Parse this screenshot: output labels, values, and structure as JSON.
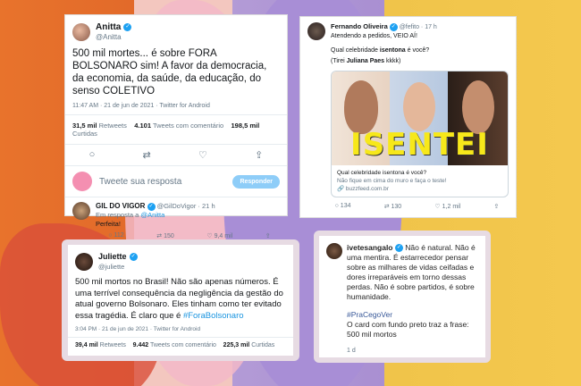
{
  "anitta": {
    "name": "Anitta",
    "handle": "@Anitta",
    "text": "500 mil mortes... é sobre FORA BOLSONARO sim! A favor da democracia, da economia, da saúde,  da educação, do senso COLETIVO",
    "meta": "11:47 AM · 21 de jun de 2021 · Twitter for Android",
    "retweets": "31,5 mil",
    "retweets_label": "Retweets",
    "comments": "4.101",
    "comments_label": "Tweets com comentário",
    "likes": "198,5 mil",
    "likes_label": "Curtidas",
    "reply_placeholder": "Tweete sua resposta",
    "reply_button": "Responder",
    "reply": {
      "name": "GIL DO VIGOR",
      "handle": "@GilDoVigor · 21 h",
      "in_reply": "Em resposta a",
      "in_reply_handle": "@Anitta",
      "text": "Perfeita!",
      "replies": "112",
      "retweets": "150",
      "likes": "9,4 mil"
    }
  },
  "fernando": {
    "name": "Fernando Oliveira",
    "handle": "@fefito · 17 h",
    "line1": "Atendendo a pedidos, VEIO AÍ!",
    "line2_pre": "Qual celebridade ",
    "line2_bold": "isentona",
    "line2_post": " é você?",
    "line3_pre": "(Tirei ",
    "line3_bold": "Juliana Paes",
    "line3_post": " kkkk)",
    "image_text": "ISENTEI",
    "link_title": "Qual celebridade isentona é você?",
    "link_desc": "Não fique em cima do muro e faça o teste!",
    "link_domain": "buzzfeed.com.br",
    "replies": "134",
    "retweets": "130",
    "likes": "1,2 mil"
  },
  "juliette": {
    "name": "Juliette",
    "handle": "@juliette",
    "text_main": "500 mil mortos no Brasil! Não são apenas números. É uma terrível consequência da negligência da gestão do atual governo Bolsonaro. Eles tinham como ter evitado essa tragédia. É claro que é ",
    "hashtag": "#ForaBolsonaro",
    "meta": "3:04 PM · 21 de jun de 2021 · Twitter for Android",
    "retweets": "39,4 mil",
    "retweets_label": "Retweets",
    "comments": "9.442",
    "comments_label": "Tweets com comentário",
    "likes": "225,3 mil",
    "likes_label": "Curtidas"
  },
  "ivete": {
    "handle": "ivetesangalo",
    "text": "Não é natural. Não é uma mentira. É estarrecedor pensar sobre as milhares de vidas ceifadas e dores irreparáveis em torno dessas perdas. Não é sobre partidos, é sobre humanidade.",
    "hashtag": "#PraCegoVer",
    "description": "O card com fundo preto traz a frase: 500 mil mortos",
    "time": "1 d"
  }
}
